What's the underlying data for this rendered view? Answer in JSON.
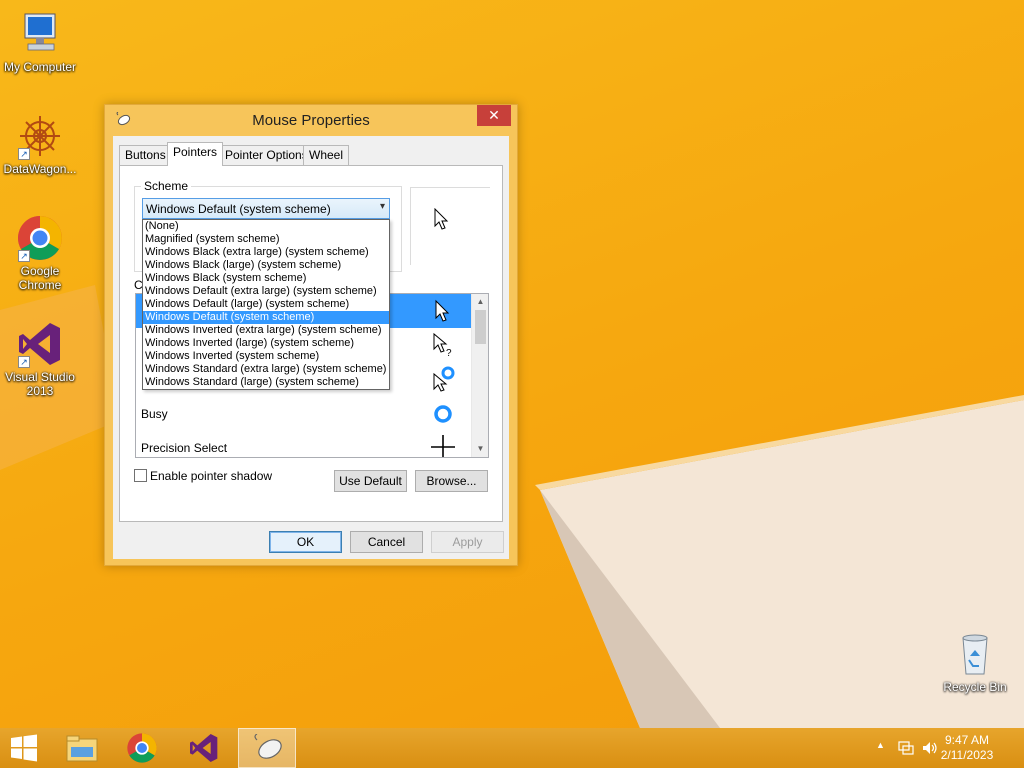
{
  "desktop": {
    "icons": [
      {
        "label": "My Computer"
      },
      {
        "label": "DataWagon..."
      },
      {
        "label": "Google Chrome"
      },
      {
        "label": "Visual Studio 2013"
      },
      {
        "label": "Recycle Bin"
      }
    ]
  },
  "dialog": {
    "title": "Mouse Properties",
    "close_glyph": "✕",
    "tabs": [
      {
        "label": "Buttons"
      },
      {
        "label": "Pointers"
      },
      {
        "label": "Pointer Options"
      },
      {
        "label": "Wheel"
      }
    ],
    "active_tab": "Pointers",
    "scheme_label": "Scheme",
    "scheme_selected": "Windows Default (system scheme)",
    "scheme_options": [
      "(None)",
      "Magnified (system scheme)",
      "Windows Black (extra large) (system scheme)",
      "Windows Black (large) (system scheme)",
      "Windows Black (system scheme)",
      "Windows Default (extra large) (system scheme)",
      "Windows Default (large) (system scheme)",
      "Windows Default (system scheme)",
      "Windows Inverted (extra large) (system scheme)",
      "Windows Inverted (large) (system scheme)",
      "Windows Inverted (system scheme)",
      "Windows Standard (extra large) (system scheme)",
      "Windows Standard (large) (system scheme)"
    ],
    "customize_label": "C",
    "pointer_rows": [
      {
        "label": "",
        "icon": "arrow-cursor-icon"
      },
      {
        "label": "",
        "icon": "help-select-cursor-icon"
      },
      {
        "label": "",
        "icon": "working-in-background-cursor-icon"
      },
      {
        "label": "Busy",
        "icon": "busy-cursor-icon"
      },
      {
        "label": "Precision Select",
        "icon": "crosshair-cursor-icon"
      }
    ],
    "shadow_label": "Enable pointer shadow",
    "use_default_label": "Use Default",
    "browse_label": "Browse...",
    "ok_label": "OK",
    "cancel_label": "Cancel",
    "apply_label": "Apply"
  },
  "taskbar": {
    "time": "9:47 AM",
    "date": "2/11/2023",
    "items": [
      "start-icon",
      "file-explorer-icon",
      "chrome-icon",
      "visual-studio-icon",
      "mouse-properties-icon"
    ]
  },
  "colors": {
    "desktop_bg": "#f6a70f",
    "selection": "#3399ff",
    "close_red": "#c7403a"
  }
}
